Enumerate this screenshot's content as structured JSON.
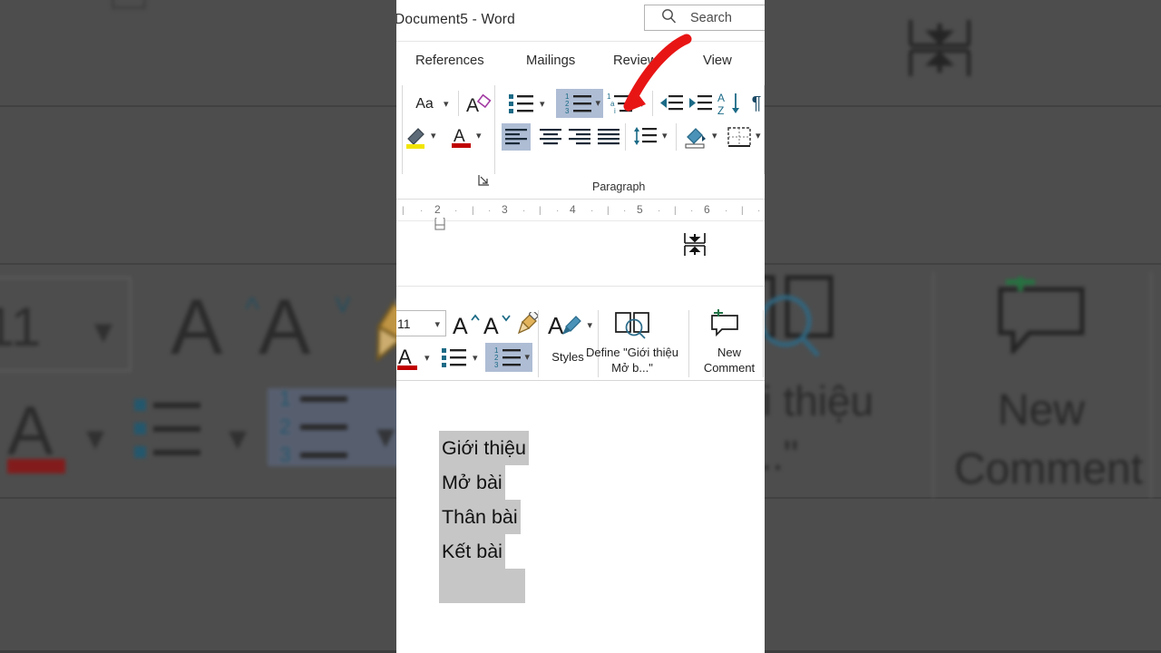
{
  "app": {
    "document_title": "Document5",
    "separator": "-",
    "app_name": "Word",
    "title_full": "Document5  -  Word"
  },
  "search": {
    "label": "Search",
    "icon": "search-icon"
  },
  "ribbon": {
    "tabs": [
      {
        "label": "References"
      },
      {
        "label": "Mailings"
      },
      {
        "label": "Review"
      },
      {
        "label": "View"
      }
    ],
    "font_group": {
      "change_case": {
        "label": "Aa",
        "icon": "change-case-icon",
        "chevron": "⌄"
      },
      "clear_formatting": {
        "icon": "clear-formatting-icon"
      },
      "text_highlight": {
        "icon": "text-highlight-color-icon",
        "color": "#f2e500",
        "chevron": "⌄"
      },
      "font_color": {
        "label": "A",
        "icon": "font-color-icon",
        "color": "#c00000",
        "chevron": "⌄"
      },
      "dialog_launcher": {
        "icon": "dialog-launcher-icon"
      }
    },
    "paragraph_group": {
      "label": "Paragraph",
      "bullets": {
        "icon": "bullet-list-icon",
        "chevron": "⌄"
      },
      "numbering": {
        "icon": "numbered-list-icon",
        "chevron": "⌄",
        "selected": true,
        "numbers": [
          "1",
          "2",
          "3"
        ]
      },
      "multilevel": {
        "icon": "multilevel-list-icon",
        "chevron": "⌄",
        "markers": [
          "1",
          "a",
          "i"
        ]
      },
      "decrease_indent": {
        "icon": "decrease-indent-icon"
      },
      "increase_indent": {
        "icon": "increase-indent-icon"
      },
      "sort": {
        "icon": "sort-icon",
        "letters": [
          "A",
          "Z"
        ]
      },
      "show_marks": {
        "icon": "paragraph-mark-icon",
        "glyph": "¶"
      },
      "align_left": {
        "icon": "align-left-icon",
        "selected": true
      },
      "align_center": {
        "icon": "align-center-icon"
      },
      "align_right": {
        "icon": "align-right-icon"
      },
      "justify": {
        "icon": "justify-icon"
      },
      "line_spacing": {
        "icon": "line-spacing-icon",
        "chevron": "⌄"
      },
      "shading": {
        "icon": "shading-icon",
        "chevron": "⌄"
      },
      "borders": {
        "icon": "borders-icon",
        "chevron": "⌄"
      }
    },
    "highlight_color": "#aebdd4"
  },
  "ruler": {
    "numbers": [
      "2",
      "3",
      "4",
      "5",
      "6"
    ],
    "indent_marker": "left-indent-marker"
  },
  "whitespace_toggle": {
    "icon": "hide-whitespace-icon"
  },
  "mini_toolbar": {
    "font_size": {
      "value": "11",
      "chevron": "⌄"
    },
    "grow_font": {
      "label": "A",
      "icon": "grow-font-icon",
      "caret": "˄"
    },
    "shrink_font": {
      "label": "A",
      "icon": "shrink-font-icon",
      "caret": "˅"
    },
    "format_painter": {
      "icon": "format-painter-icon"
    },
    "font_color": {
      "label": "A",
      "icon": "font-color-icon",
      "color": "#c00000",
      "chevron": "⌄"
    },
    "bullets": {
      "icon": "bullet-list-icon",
      "chevron": "⌄"
    },
    "numbering": {
      "icon": "numbered-list-icon",
      "chevron": "⌄",
      "selected": true,
      "numbers": [
        "1",
        "2",
        "3"
      ]
    },
    "styles": {
      "label": "Styles",
      "icon": "styles-icon",
      "chevron": "⌄"
    },
    "define": {
      "label_line1": "Define \"Giới thiệu",
      "label_line2": "Mở b...\"",
      "icon": "define-dictionary-icon"
    },
    "new_comment": {
      "label_line1": "New",
      "label_line2": "Comment",
      "icon": "new-comment-icon",
      "plus_color": "#217346"
    }
  },
  "document": {
    "lines": [
      "Giới thiệu",
      "Mở bài",
      "Thân bài",
      "Kết bài"
    ],
    "selection_color": "#c6c6c6"
  },
  "annotation": {
    "arrow": "red-curved-arrow",
    "color": "#e81515"
  },
  "background": {
    "overlay_color": "#4d4d4d",
    "ghost_define_line1": "iới thiệu",
    "ghost_define_line2": "b...\"",
    "ghost_new": "New",
    "ghost_comment": "Comment",
    "ghost_font_size": "11"
  }
}
